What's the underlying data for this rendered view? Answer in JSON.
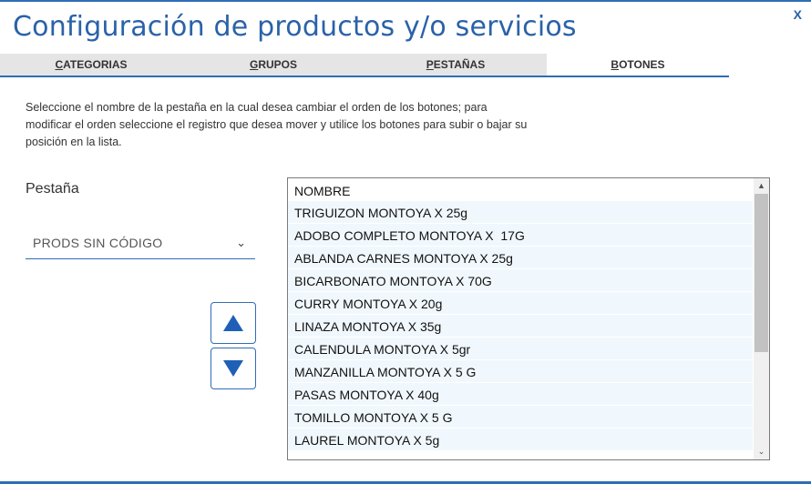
{
  "window": {
    "title": "Configuración de productos y/o servicios",
    "close_label": "X"
  },
  "tabs": [
    {
      "first": "C",
      "rest": "ATEGORIAS",
      "active": false
    },
    {
      "first": "G",
      "rest": "RUPOS",
      "active": false
    },
    {
      "first": "P",
      "rest": "ESTAÑAS",
      "active": false
    },
    {
      "first": "B",
      "rest": "OTONES",
      "active": true
    }
  ],
  "instructions": "Seleccione el nombre de la pestaña en la cual desea cambiar el orden de los botones; para modificar el orden seleccione el registro que desea mover y utilice los botones para subir o bajar su posición en la lista.",
  "pestana": {
    "label": "Pestaña",
    "selected": "PRODS SIN CÓDIGO"
  },
  "list": {
    "header": "NOMBRE",
    "items": [
      "TRIGUIZON MONTOYA X 25g",
      "ADOBO COMPLETO MONTOYA X  17G",
      "ABLANDA CARNES MONTOYA X 25g",
      "BICARBONATO MONTOYA X 70G",
      "CURRY MONTOYA X 20g",
      "LINAZA MONTOYA X 35g",
      "CALENDULA MONTOYA X 5gr",
      "MANZANILLA MONTOYA X 5 G",
      "PASAS MONTOYA X 40g",
      "TOMILLO MONTOYA X 5 G",
      "LAUREL MONTOYA X 5g"
    ]
  },
  "colors": {
    "accent": "#2f6db5",
    "row_bg": "#f1f8fd"
  }
}
